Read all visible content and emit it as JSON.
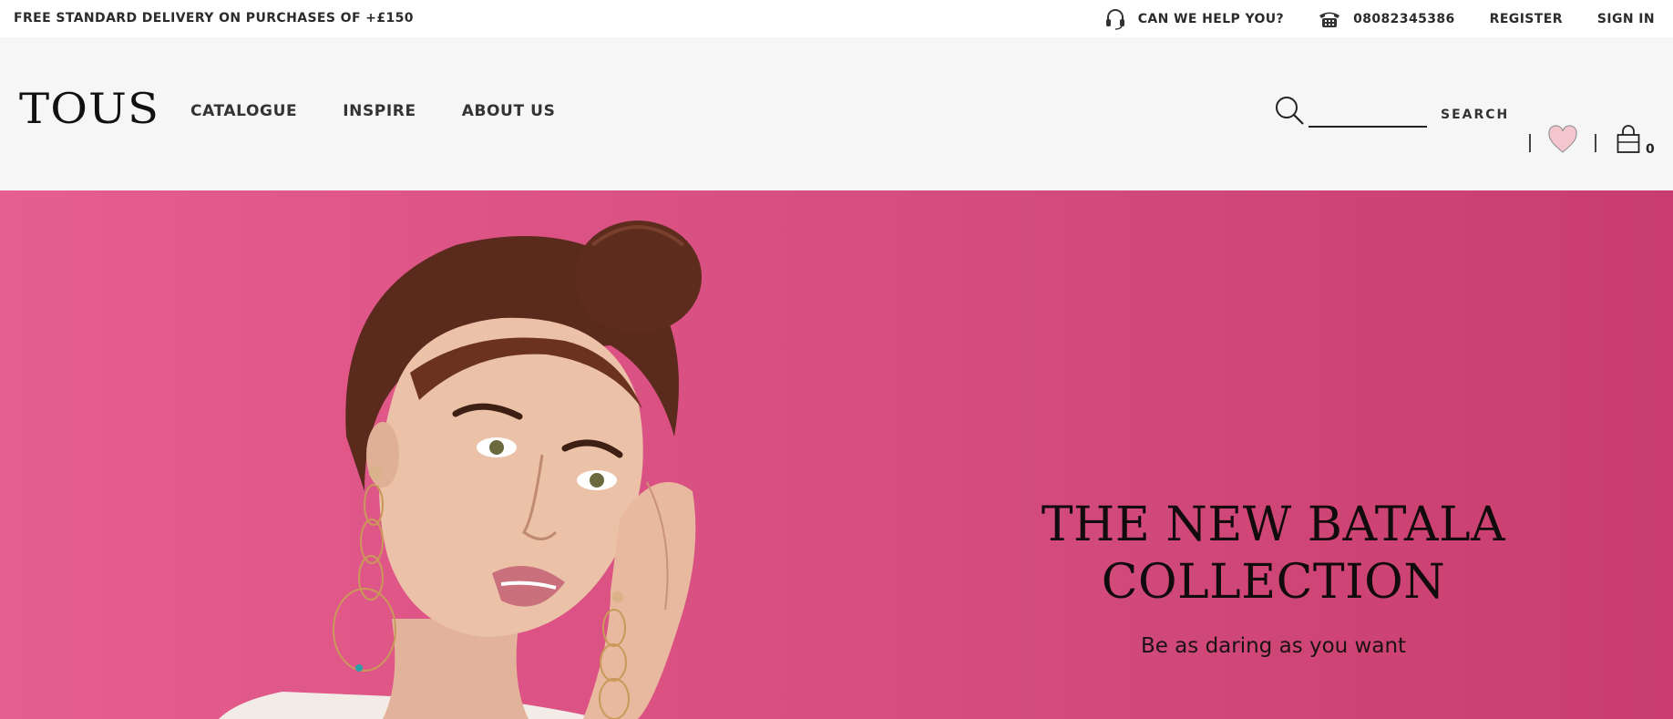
{
  "topbar": {
    "promo": "FREE STANDARD DELIVERY ON PURCHASES OF +£150",
    "help": "CAN WE HELP YOU?",
    "phone": "08082345386",
    "register": "REGISTER",
    "sign_in": "SIGN IN"
  },
  "header": {
    "logo": "TOUS",
    "nav": [
      "CATALOGUE",
      "INSPIRE",
      "ABOUT US"
    ],
    "search_button": "SEARCH",
    "search_placeholder": "",
    "cart_count": "0"
  },
  "hero": {
    "title_line1": "THE NEW BATALA",
    "title_line2": "COLLECTION",
    "subtitle": "Be as daring as you want"
  },
  "colors": {
    "hero_background": "#d34c7d",
    "header_background": "#f6f6f6",
    "wishlist_heart": "#f2c6cc"
  },
  "icons": [
    "headset-icon",
    "phone-icon",
    "search-icon",
    "heart-icon",
    "shopping-bag-icon"
  ]
}
